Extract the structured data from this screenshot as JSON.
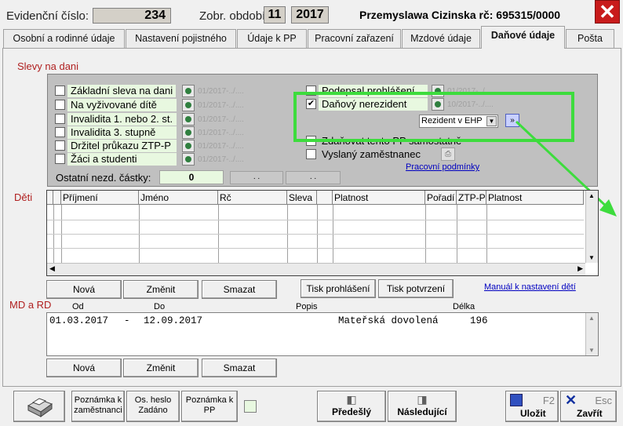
{
  "header": {
    "evid_label": "Evidenční číslo:",
    "evid_value": "234",
    "period_label": "Zobr. období:",
    "period_month": "11",
    "period_year": "2017",
    "person": "Przemyslawa Cizinska rč: 695315/0000",
    "close_glyph": "✕"
  },
  "tabs": [
    {
      "label": "Osobní a rodinné údaje"
    },
    {
      "label": "Nastavení pojistného"
    },
    {
      "label": "Údaje k PP"
    },
    {
      "label": "Pracovní zařazení"
    },
    {
      "label": "Mzdové údaje"
    },
    {
      "label": "Daňové údaje"
    },
    {
      "label": "Pošta"
    }
  ],
  "slevy": {
    "title": "Slevy na dani",
    "left_items": [
      {
        "label": "Základní sleva na dani",
        "date": "01/2017-../...."
      },
      {
        "label": "Na vyživované dítě",
        "date": "01/2017-../...."
      },
      {
        "label": "Invalidita 1. nebo 2. st.",
        "date": "01/2017-../...."
      },
      {
        "label": "Invalidita 3. stupně",
        "date": "01/2017-../...."
      },
      {
        "label": "Držitel průkazu ZTP-P",
        "date": "01/2017-../...."
      },
      {
        "label": "Žáci a studenti",
        "date": "01/2017-../...."
      }
    ],
    "right_items": [
      {
        "label": "Podepsal prohlášení",
        "date": "01/2017-../...."
      },
      {
        "label": "Daňový nerezident",
        "date": "10/2017-../....",
        "checked": "✔"
      }
    ],
    "resident_select": "Rezident  v EHP",
    "zdanovat": "Zdaňovat tento PP samostatně",
    "vyslany": "Vyslaný zaměstnanec",
    "pracovni_link": "Pracovní podmínky",
    "ostatni_label": "Ostatní nezd. částky:",
    "ostatni_value": "0",
    "ostatni_f1": ". .",
    "ostatni_f2": ". ."
  },
  "deti": {
    "title": "Děti",
    "columns": [
      "Příjmení",
      "Jméno",
      "Rč",
      "Sleva",
      "",
      "Platnost",
      "Pořadí",
      "ZTP-P",
      "Platnost"
    ],
    "btn_new": "Nová",
    "btn_edit": "Změnit",
    "btn_delete": "Smazat",
    "btn_tisk_prohl": "Tisk prohlášení",
    "btn_tisk_potvr": "Tisk potvrzení",
    "manual_link": "Manuál k nastavení dětí"
  },
  "mdrd": {
    "title": "MD a RD",
    "col_od": "Od",
    "col_do": "Do",
    "col_popis": "Popis",
    "col_delka": "Délka",
    "row_od": "01.03.2017",
    "row_dash": "-",
    "row_do": "12.09.2017",
    "row_popis": "Mateřská dovolená",
    "row_delka": "196",
    "btn_new": "Nová",
    "btn_edit": "Změnit",
    "btn_delete": "Smazat"
  },
  "bottom": {
    "poznamka_zam": "Poznámka k zaměstnanci",
    "os_heslo": "Os. heslo Zadáno",
    "poznamka_pp": "Poznámka k PP",
    "predesly": "Předešlý",
    "nasledujici": "Následující",
    "ulozit": "Uložit",
    "ulozit_key": "F2",
    "zavrit": "Zavřít",
    "zavrit_key": "Esc"
  },
  "colors": {
    "highlight": "#3ddc3d",
    "arrow": "#3ddc3d",
    "section_label": "#b02020"
  }
}
